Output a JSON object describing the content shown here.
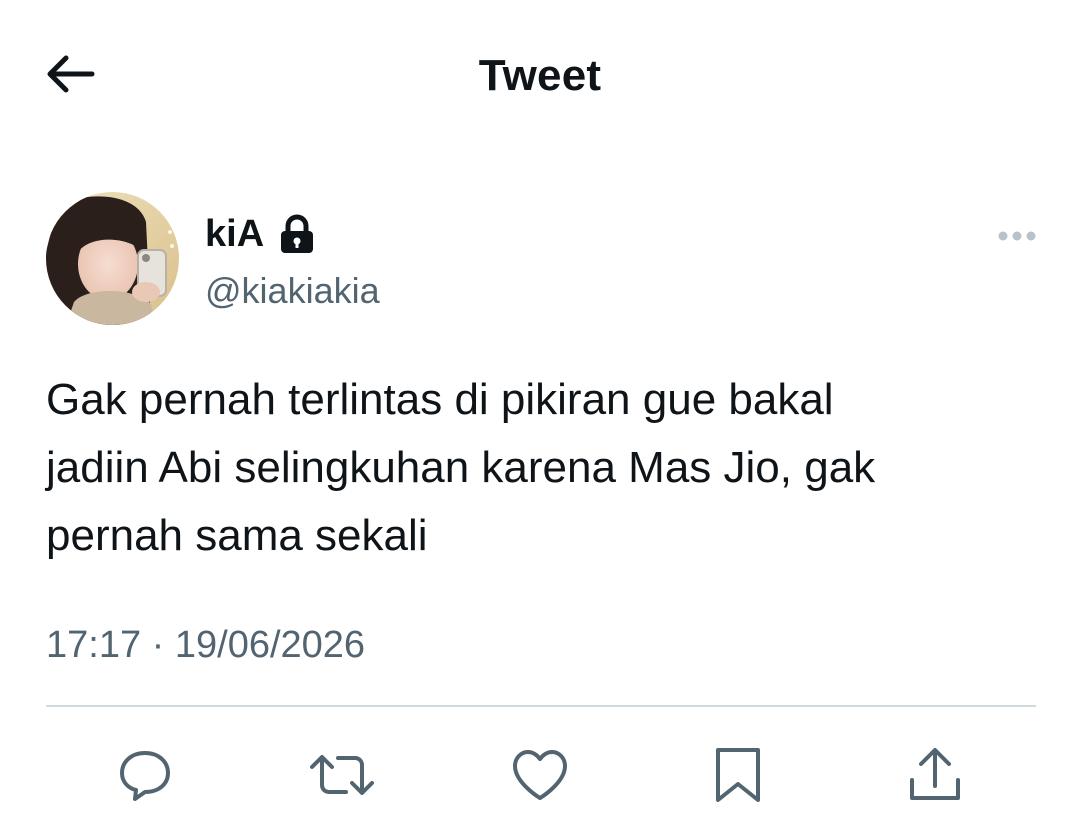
{
  "header": {
    "title": "Tweet",
    "back_icon": "arrow-left-icon"
  },
  "author": {
    "display_name": "kiA",
    "protected_icon": "lock-icon",
    "handle": "@kiakiakia",
    "avatar": "avatar-photo"
  },
  "tweet": {
    "text_lines": [
      "Gak pernah terlintas di pikiran gue bakal",
      "jadiin Abi selingkuhan karena Mas Jio, gak",
      "pernah sama sekali"
    ],
    "time": "17:17",
    "separator": "·",
    "date": "19/06/2026"
  },
  "more_icon": "more-dots-icon",
  "actions": [
    {
      "name": "reply",
      "icon": "reply-icon"
    },
    {
      "name": "retweet",
      "icon": "retweet-icon"
    },
    {
      "name": "like",
      "icon": "heart-icon"
    },
    {
      "name": "bookmark",
      "icon": "bookmark-icon"
    },
    {
      "name": "share",
      "icon": "share-icon"
    }
  ],
  "colors": {
    "text_primary": "#0f1419",
    "text_secondary": "#536471",
    "divider": "#cfd9de"
  }
}
